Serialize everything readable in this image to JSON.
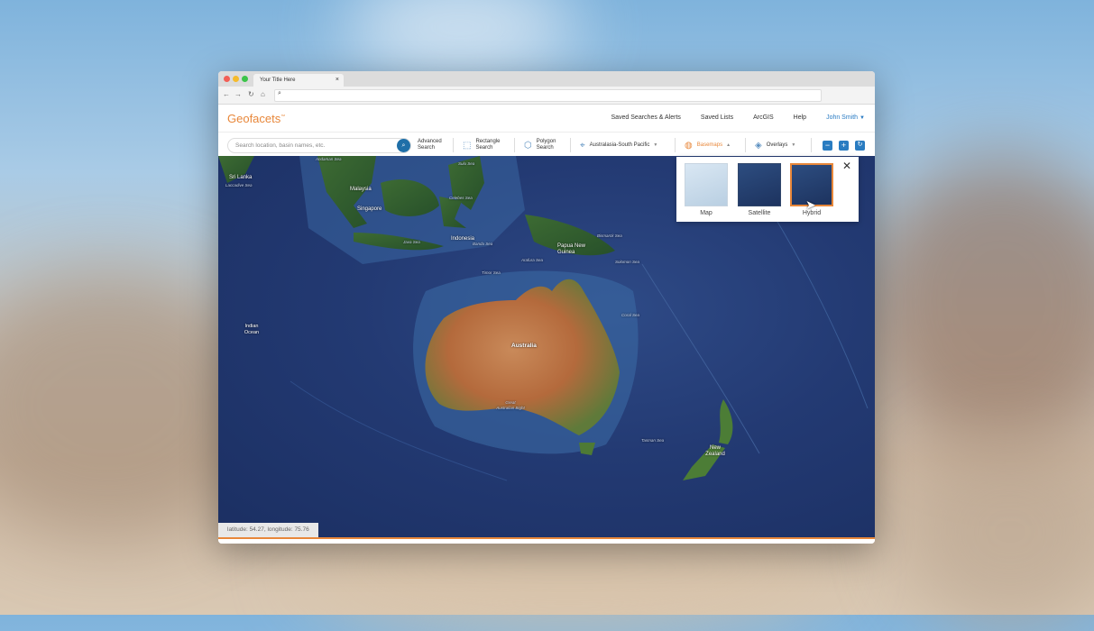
{
  "browser": {
    "tab_title": "Your Title Here",
    "tab_close": "×"
  },
  "app": {
    "logo": "Geofacets",
    "logo_tm": "™",
    "nav": {
      "saved_searches": "Saved Searches & Alerts",
      "saved_lists": "Saved Lists",
      "arcgis": "ArcGIS",
      "help": "Help",
      "user": "John Smith"
    }
  },
  "toolbar": {
    "search_placeholder": "Search location, basin names, etc.",
    "advanced_search": "Advanced Search",
    "rectangle_search": "Rectangle Search",
    "polygon_search": "Polygon Search",
    "region": "Australasia-South Pacific",
    "basemaps": "Basemaps",
    "overlays": "Overlays"
  },
  "basemap_panel": {
    "options": [
      {
        "label": "Map"
      },
      {
        "label": "Satellite"
      },
      {
        "label": "Hybrid",
        "selected": true
      }
    ],
    "close": "✕"
  },
  "map_labels": {
    "sri_lanka": "Sri Lanka",
    "laccadive_sea": "Laccadive Sea",
    "andaman_sea": "Andaman Sea",
    "malaysia": "Malaysia",
    "singapore": "Singapore",
    "sulu_sea": "Sulu Sea",
    "celebes_sea": "Celebes Sea",
    "indonesia": "Indonesia",
    "java_sea": "Java Sea",
    "banda_sea": "Banda Sea",
    "papua_new_guinea": "Papua New Guinea",
    "bismarck_sea": "Bismarck Sea",
    "solomon_sea": "Solomon Sea",
    "timor_sea": "Timor Sea",
    "arafura_sea": "Arafura Sea",
    "coral_sea": "Coral Sea",
    "indian_ocean": "Indian Ocean",
    "australia": "Australia",
    "great_australian_bight": "Great Australian Bight",
    "tasman_sea": "Tasman Sea",
    "new_zealand": "New Zealand"
  },
  "status": {
    "coordinates": "latitude: 54.27, longitude: 75.76"
  },
  "colors": {
    "accent": "#e8873a",
    "primary": "#2a7cc1"
  }
}
